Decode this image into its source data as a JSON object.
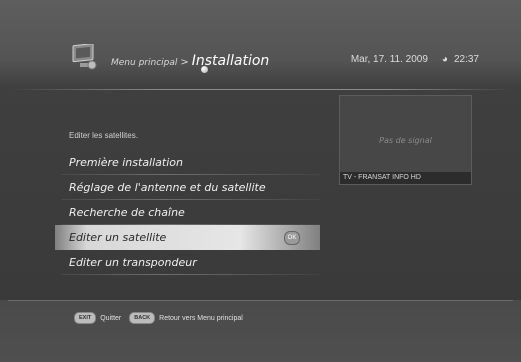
{
  "header": {
    "breadcrumb_parent": "Menu principal",
    "breadcrumb_separator": ">",
    "title": "Installation",
    "date": "Mar, 17. 11. 2009",
    "time": "22:37"
  },
  "hint": "Editer les satellites.",
  "menu": {
    "items": [
      {
        "label": "Première installation"
      },
      {
        "label": "Réglage de l'antenne et du satellite"
      },
      {
        "label": "Recherche de chaîne"
      },
      {
        "label": "Editer un satellite",
        "selected": true
      },
      {
        "label": "Editer un transpondeur"
      }
    ],
    "ok_badge": "OK"
  },
  "preview": {
    "status": "Pas de signal",
    "channel": "TV - FRANSAT INFO HD"
  },
  "footer": {
    "exit_key": "EXIT",
    "exit_label": "Quitter",
    "back_key": "BACK",
    "back_label": "Retour vers Menu principal"
  },
  "icons": {
    "header": "installation-tv-icon",
    "clock": "clock-icon"
  },
  "colors": {
    "background": "#3a3a3a",
    "selected_bar": "#e0e0e0",
    "text": "#f0f0f0"
  }
}
